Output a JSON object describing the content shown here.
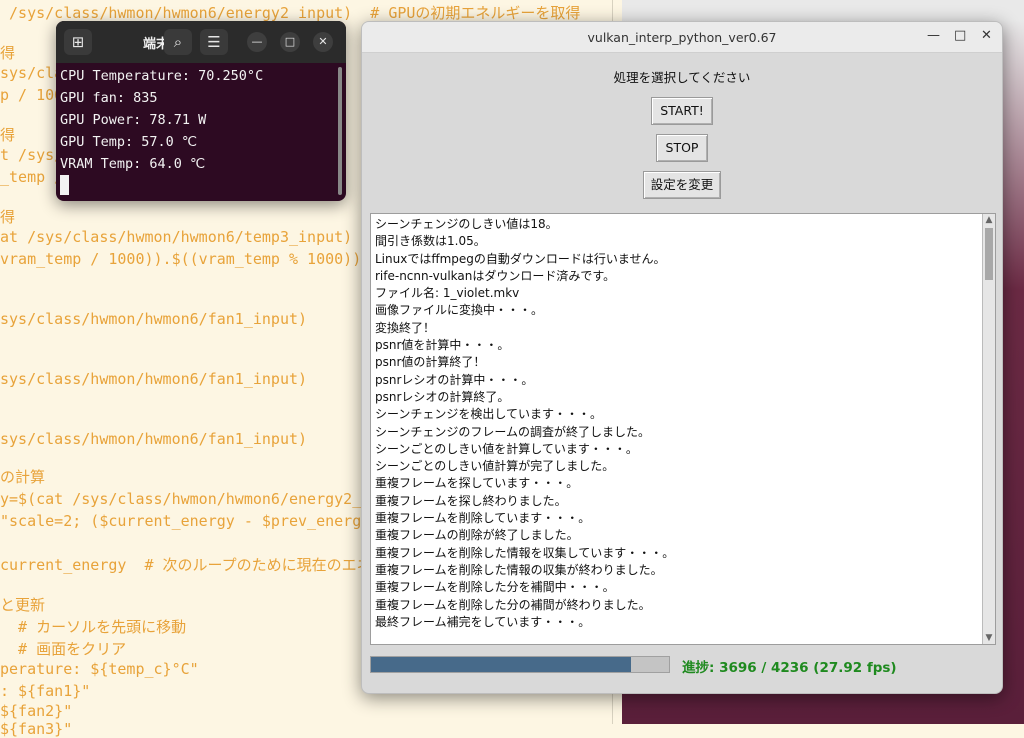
{
  "editor": {
    "lines": [
      " /sys/class/hwmon/hwmon6/energy2_input)  # GPUの初期エネルギーを取得",
      "得",
      "sys/clas",
      "p / 100",
      "得",
      "t /sys/",
      "_temp /",
      "得",
      "at /sys/class/hwmon/hwmon6/temp3_input)",
      "vram_temp / 1000)).$((vram_temp % 1000))",
      "sys/class/hwmon/hwmon6/fan1_input)",
      "sys/class/hwmon/hwmon6/fan1_input)",
      "sys/class/hwmon/hwmon6/fan1_input)",
      "の計算",
      "y=$(cat /sys/class/hwmon/hwmon6/energy2_inp",
      "\"scale=2; ($current_energy - $prev_energy)",
      "current_energy  # 次のループのために現在のエネル",
      "と更新",
      "  # カーソルを先頭に移動",
      "  # 画面をクリア",
      "perature: ${temp_c}°C\"",
      ": ${fan1}\"",
      "${fan2}\"",
      "${fan3}\""
    ]
  },
  "terminal": {
    "title": "端末",
    "lines": [
      "CPU Temperature: 70.250°C",
      "GPU fan: 835",
      "GPU Power: 78.71 W",
      "GPU Temp: 57.0 ℃",
      "VRAM Temp: 64.0 ℃"
    ]
  },
  "app": {
    "title": "vulkan_interp_python_ver0.67",
    "prompt": "処理を選択してください",
    "start_label": "START!",
    "stop_label": "STOP",
    "settings_label": "設定を変更",
    "log_lines": [
      "シーンチェンジのしきい値は18。",
      "間引き係数は1.05。",
      "Linuxではffmpegの自動ダウンロードは行いません。",
      "rife-ncnn-vulkanはダウンロード済みです。",
      "ファイル名: 1_violet.mkv",
      "画像ファイルに変換中・・・。",
      "変換終了！",
      "psnr値を計算中・・・。",
      "psnr値の計算終了！",
      "psnrレシオの計算中・・・。",
      "psnrレシオの計算終了。",
      "シーンチェンジを検出しています・・・。",
      "シーンチェンジのフレームの調査が終了しました。",
      "シーンごとのしきい値を計算しています・・・。",
      "シーンごとのしきい値計算が完了しました。",
      "重複フレームを探しています・・・。",
      "重複フレームを探し終わりました。",
      "重複フレームを削除しています・・・。",
      "重複フレームの削除が終了しました。",
      "重複フレームを削除した情報を収集しています・・・。",
      "重複フレームを削除した情報の収集が終わりました。",
      "重複フレームを削除した分を補間中・・・。",
      "重複フレームを削除した分の補間が終わりました。",
      "最終フレーム補完をしています・・・。"
    ],
    "progress_fraction": 0.873,
    "progress_text": "進捗: 3696 / 4236   (27.92 fps)"
  }
}
